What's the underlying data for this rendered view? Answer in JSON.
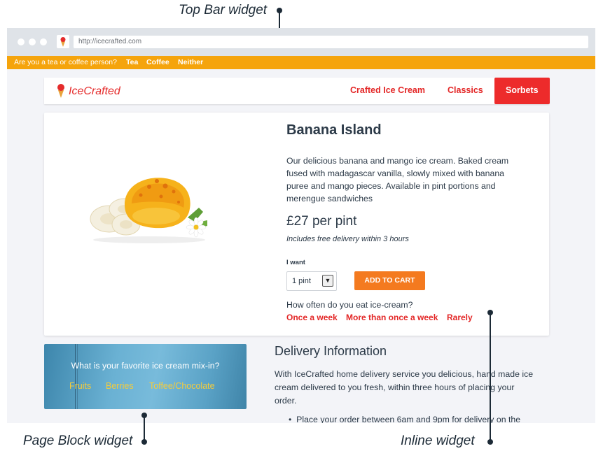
{
  "annotations": {
    "top_bar": "Top Bar widget",
    "page_block": "Page Block widget",
    "inline": "Inline widget"
  },
  "browser": {
    "url": "http://icecrafted.com"
  },
  "topbar": {
    "question": "Are you a tea or coffee person?",
    "options": [
      "Tea",
      "Coffee",
      "Neither"
    ]
  },
  "nav": {
    "logo": "IceCrafted",
    "links": [
      "Crafted Ice Cream",
      "Classics",
      "Sorbets"
    ],
    "active": "Sorbets"
  },
  "product": {
    "title": "Banana Island",
    "description": "Our delicious banana and mango ice cream. Baked cream fused with madagascar vanilla, slowly mixed with banana puree and mango pieces. Available in pint portions and merengue sandwiches",
    "price": "£27 per pint",
    "delivery_note": "Includes free delivery within 3 hours",
    "quantity_label": "I want",
    "quantity_value": "1 pint",
    "add_to_cart": "ADD TO CART",
    "survey_question": "How often do you eat ice-cream?",
    "survey_options": [
      "Once a week",
      "More than once a week",
      "Rarely"
    ]
  },
  "mixin_widget": {
    "question": "What is your favorite ice cream mix-in?",
    "options": [
      "Fruits",
      "Berries",
      "Toffee/Chocolate"
    ]
  },
  "delivery": {
    "title": "Delivery Information",
    "body": "With IceCrafted home delivery service you delicious, hand made ice cream delivered to you fresh, within three hours of placing your order.",
    "bullet": "Place your order between 6am and 9pm for delivery on the"
  },
  "colors": {
    "brand_red": "#e32626",
    "topbar_orange": "#f5a40c",
    "cart_orange": "#f47a1f",
    "mixin_yellow": "#f6cc3a"
  }
}
